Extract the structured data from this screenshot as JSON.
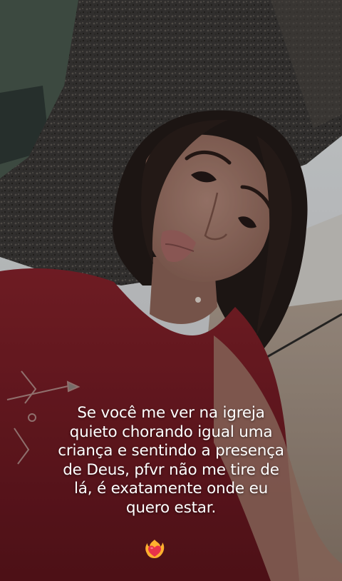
{
  "story": {
    "caption_lines": [
      "Se você me ver na igreja",
      "quieto chorando igual uma",
      "criança e sentindo a presença",
      "de Deus, pfvr não me tire de",
      "lá, é exatamente onde eu",
      "quero estar."
    ],
    "emoji_icon": "heart-on-fire-emoji",
    "colors": {
      "caption_text": "#ffffff",
      "shirt": "#7a1c24",
      "tree_bark": "#3a3836",
      "sky": "#dfe2e4",
      "emoji_heart": "#e8324a",
      "emoji_flame": "#ffb02e"
    }
  }
}
